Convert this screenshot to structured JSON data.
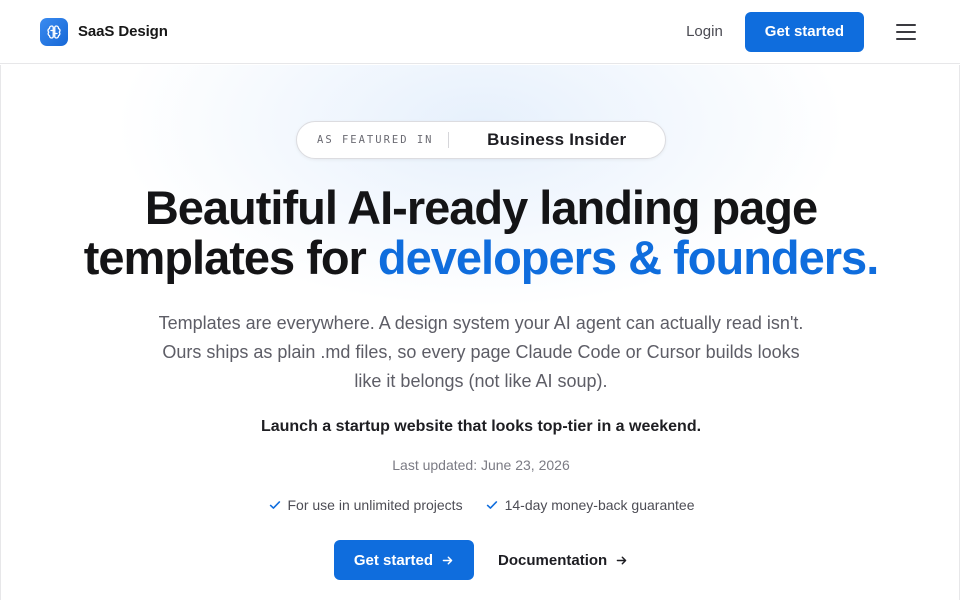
{
  "nav": {
    "brand_name": "SaaS Design",
    "login_label": "Login",
    "cta_label": "Get started",
    "menu_icon": "hamburger-icon",
    "brand_icon": "brain-icon"
  },
  "hero": {
    "featured_label": "AS FEATURED IN",
    "featured_name": "Business Insider",
    "headline_line1": "Beautiful AI-ready landing page",
    "headline_line2_plain": "templates for ",
    "headline_line2_accent": "developers & founders.",
    "subtext": "Templates are everywhere. A design system your AI agent can actually read isn't. Ours ships as plain .md files, so every page Claude Code or Cursor builds looks like it belongs (not like AI soup).",
    "tagline": "Launch a startup website that looks top-tier in a weekend.",
    "last_updated": "Last updated: June 23, 2026",
    "features": [
      {
        "label": "For use in unlimited projects",
        "icon": "check-icon"
      },
      {
        "label": "14-day money-back guarantee",
        "icon": "check-icon"
      }
    ],
    "cta_primary": "Get started",
    "cta_secondary": "Documentation"
  },
  "colors": {
    "accent": "#0f6ddd",
    "text": "#141416",
    "muted": "#5d5d66",
    "border": "#e7e7e9"
  }
}
